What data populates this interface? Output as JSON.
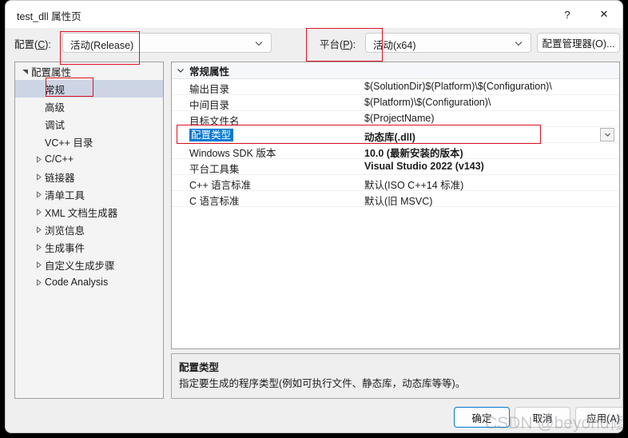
{
  "window": {
    "title": "test_dll 属性页",
    "help_label": "?",
    "close_label": "✕"
  },
  "config_bar": {
    "config_label_prefix": "配置",
    "config_label_key": "C",
    "config_label_suffix": ":",
    "config_value": "活动(Release)",
    "platform_label_prefix": "平台",
    "platform_label_key": "P",
    "platform_label_suffix": ":",
    "platform_value": "活动(x64)",
    "config_manager_label": "配置管理器(O)...",
    "chevron_icon": "chevron-down-icon"
  },
  "tree": {
    "items": [
      {
        "label": "配置属性",
        "indent": 0,
        "arrow": "expanded",
        "selected": false
      },
      {
        "label": "常规",
        "indent": 1,
        "arrow": "none",
        "selected": true
      },
      {
        "label": "高级",
        "indent": 1,
        "arrow": "none",
        "selected": false
      },
      {
        "label": "调试",
        "indent": 1,
        "arrow": "none",
        "selected": false
      },
      {
        "label": "VC++ 目录",
        "indent": 1,
        "arrow": "none",
        "selected": false
      },
      {
        "label": "C/C++",
        "indent": 1,
        "arrow": "collapsed",
        "selected": false
      },
      {
        "label": "链接器",
        "indent": 1,
        "arrow": "collapsed",
        "selected": false
      },
      {
        "label": "清单工具",
        "indent": 1,
        "arrow": "collapsed",
        "selected": false
      },
      {
        "label": "XML 文档生成器",
        "indent": 1,
        "arrow": "collapsed",
        "selected": false
      },
      {
        "label": "浏览信息",
        "indent": 1,
        "arrow": "collapsed",
        "selected": false
      },
      {
        "label": "生成事件",
        "indent": 1,
        "arrow": "collapsed",
        "selected": false
      },
      {
        "label": "自定义生成步骤",
        "indent": 1,
        "arrow": "collapsed",
        "selected": false
      },
      {
        "label": "Code Analysis",
        "indent": 1,
        "arrow": "collapsed",
        "selected": false
      }
    ]
  },
  "grid": {
    "group_header": "常规属性",
    "group_chevron_icon": "chevron-down-icon",
    "rows": [
      {
        "name": "输出目录",
        "value": "$(SolutionDir)$(Platform)\\$(Configuration)\\",
        "bold": false,
        "selected": false,
        "dropdown": false
      },
      {
        "name": "中间目录",
        "value": "$(Platform)\\$(Configuration)\\",
        "bold": false,
        "selected": false,
        "dropdown": false
      },
      {
        "name": "目标文件名",
        "value": "$(ProjectName)",
        "bold": false,
        "selected": false,
        "dropdown": false
      },
      {
        "name": "配置类型",
        "value": "动态库(.dll)",
        "bold": true,
        "selected": true,
        "dropdown": true
      },
      {
        "name": "Windows SDK 版本",
        "value": "10.0 (最新安装的版本)",
        "bold": true,
        "selected": false,
        "dropdown": false
      },
      {
        "name": "平台工具集",
        "value": "Visual Studio 2022 (v143)",
        "bold": true,
        "selected": false,
        "dropdown": false
      },
      {
        "name": "C++ 语言标准",
        "value": "默认(ISO C++14 标准)",
        "bold": false,
        "selected": false,
        "dropdown": false
      },
      {
        "name": "C 语言标准",
        "value": "默认(旧 MSVC)",
        "bold": false,
        "selected": false,
        "dropdown": false
      }
    ]
  },
  "description": {
    "title": "配置类型",
    "text": "指定要生成的程序类型(例如可执行文件、静态库，动态库等等)。"
  },
  "footer": {
    "ok_label": "确定",
    "cancel_label": "取消",
    "apply_label": "应用(A)"
  },
  "watermark": {
    "text": "CSDN @beyond修治"
  },
  "colors": {
    "selection_blue": "#0078d4",
    "tree_selection": "#cdd5e5",
    "annotation_red": "#e01020",
    "dialog_bg": "#efefef"
  }
}
